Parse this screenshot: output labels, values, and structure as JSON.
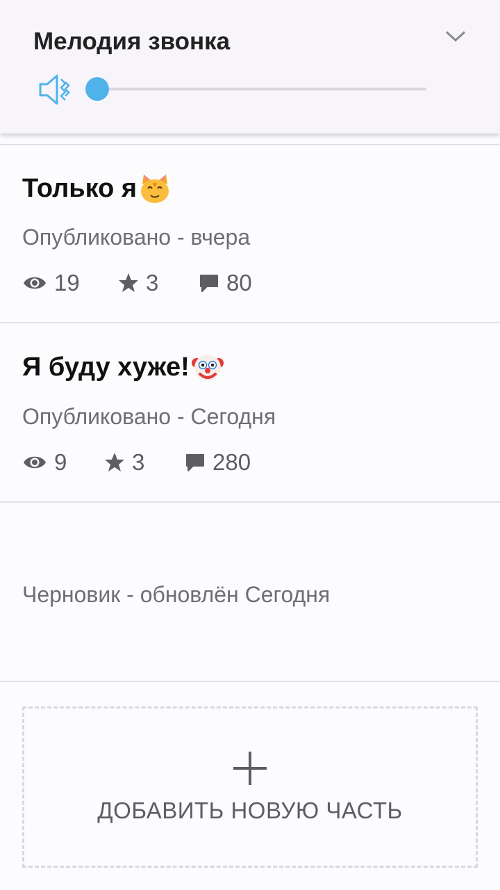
{
  "volume_panel": {
    "title": "Мелодия звонка",
    "level_fraction": 0.0,
    "accent_color": "#4fb3ea",
    "icons": [
      "volume-mute-icon",
      "chevron-down-icon"
    ]
  },
  "parts": [
    {
      "title": "Только я",
      "emoji": "cat-face-icon",
      "status": "Опубликовано - вчера",
      "views": "19",
      "votes": "3",
      "comments": "80"
    },
    {
      "title": "Я буду хуже!",
      "emoji": "clown-face-icon",
      "status": "Опубликовано - Сегодня",
      "views": "9",
      "votes": "3",
      "comments": "280"
    },
    {
      "title": "",
      "status": "Черновик - обновлён Сегодня"
    }
  ],
  "add_part": {
    "label": "ДОБАВИТЬ НОВУЮ ЧАСТЬ"
  }
}
